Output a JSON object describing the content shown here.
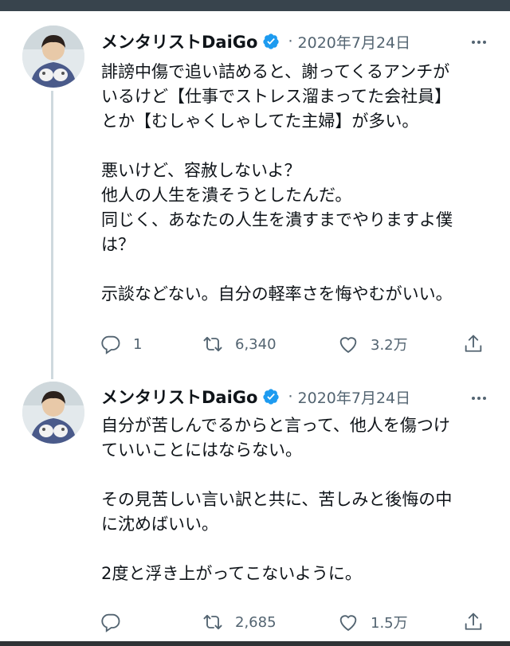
{
  "status_bar_color": "#38444d",
  "accent_color": "#1d9bf0",
  "tweets": [
    {
      "author": "メンタリストDaiGo",
      "verified": true,
      "separator": "·",
      "date": "2020年7月24日",
      "lines": [
        "誹謗中傷で追い詰めると、謝ってくるアンチが",
        "いるけど【仕事でストレス溜まってた会社員】",
        "とか【むしゃくしゃしてた主婦】が多い。",
        "",
        "悪いけど、容赦しないよ？",
        "他人の人生を潰そうとしたんだ。",
        "同じく、あなたの人生を潰すまでやりますよ僕",
        "は？",
        "",
        "示談などない。自分の軽率さを悔やむがいい。"
      ],
      "reply_count": "1",
      "retweet_count": "6,340",
      "like_count": "3.2万"
    },
    {
      "author": "メンタリストDaiGo",
      "verified": true,
      "separator": "·",
      "date": "2020年7月24日",
      "lines": [
        "自分が苦しんでるからと言って、他人を傷つけ",
        "ていいことにはならない。",
        "",
        "その見苦しい言い訳と共に、苦しみと後悔の中",
        "に沈めばいい。",
        "",
        "2度と浮き上がってこないように。"
      ],
      "reply_count": "",
      "retweet_count": "2,685",
      "like_count": "1.5万"
    }
  ],
  "icons": {
    "verified": "verified-badge-icon",
    "more": "more-horizontal-icon",
    "reply": "reply-icon",
    "retweet": "retweet-icon",
    "like": "heart-icon",
    "share": "share-icon"
  }
}
